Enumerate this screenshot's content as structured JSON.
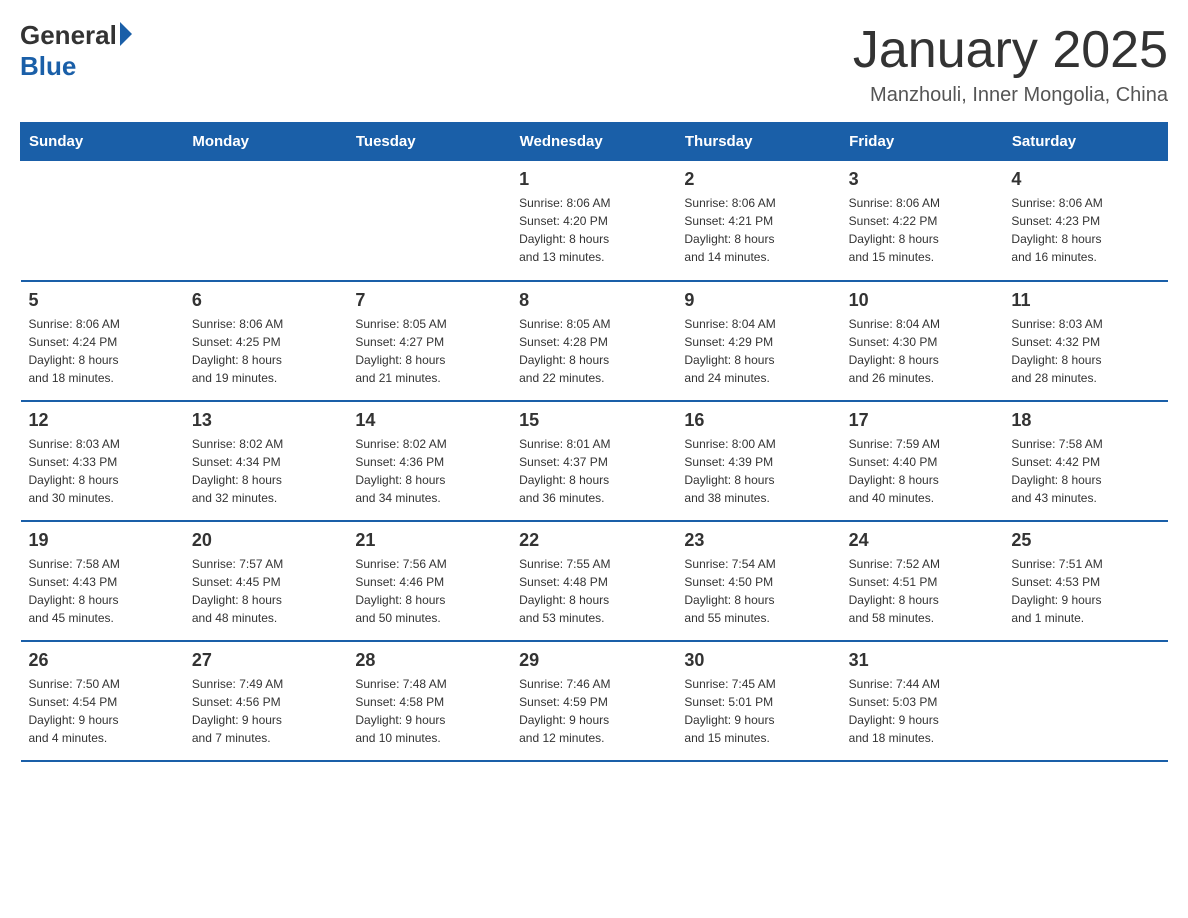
{
  "logo": {
    "general": "General",
    "blue": "Blue"
  },
  "header": {
    "title": "January 2025",
    "subtitle": "Manzhouli, Inner Mongolia, China"
  },
  "weekdays": [
    "Sunday",
    "Monday",
    "Tuesday",
    "Wednesday",
    "Thursday",
    "Friday",
    "Saturday"
  ],
  "weeks": [
    [
      {
        "day": "",
        "info": ""
      },
      {
        "day": "",
        "info": ""
      },
      {
        "day": "",
        "info": ""
      },
      {
        "day": "1",
        "info": "Sunrise: 8:06 AM\nSunset: 4:20 PM\nDaylight: 8 hours\nand 13 minutes."
      },
      {
        "day": "2",
        "info": "Sunrise: 8:06 AM\nSunset: 4:21 PM\nDaylight: 8 hours\nand 14 minutes."
      },
      {
        "day": "3",
        "info": "Sunrise: 8:06 AM\nSunset: 4:22 PM\nDaylight: 8 hours\nand 15 minutes."
      },
      {
        "day": "4",
        "info": "Sunrise: 8:06 AM\nSunset: 4:23 PM\nDaylight: 8 hours\nand 16 minutes."
      }
    ],
    [
      {
        "day": "5",
        "info": "Sunrise: 8:06 AM\nSunset: 4:24 PM\nDaylight: 8 hours\nand 18 minutes."
      },
      {
        "day": "6",
        "info": "Sunrise: 8:06 AM\nSunset: 4:25 PM\nDaylight: 8 hours\nand 19 minutes."
      },
      {
        "day": "7",
        "info": "Sunrise: 8:05 AM\nSunset: 4:27 PM\nDaylight: 8 hours\nand 21 minutes."
      },
      {
        "day": "8",
        "info": "Sunrise: 8:05 AM\nSunset: 4:28 PM\nDaylight: 8 hours\nand 22 minutes."
      },
      {
        "day": "9",
        "info": "Sunrise: 8:04 AM\nSunset: 4:29 PM\nDaylight: 8 hours\nand 24 minutes."
      },
      {
        "day": "10",
        "info": "Sunrise: 8:04 AM\nSunset: 4:30 PM\nDaylight: 8 hours\nand 26 minutes."
      },
      {
        "day": "11",
        "info": "Sunrise: 8:03 AM\nSunset: 4:32 PM\nDaylight: 8 hours\nand 28 minutes."
      }
    ],
    [
      {
        "day": "12",
        "info": "Sunrise: 8:03 AM\nSunset: 4:33 PM\nDaylight: 8 hours\nand 30 minutes."
      },
      {
        "day": "13",
        "info": "Sunrise: 8:02 AM\nSunset: 4:34 PM\nDaylight: 8 hours\nand 32 minutes."
      },
      {
        "day": "14",
        "info": "Sunrise: 8:02 AM\nSunset: 4:36 PM\nDaylight: 8 hours\nand 34 minutes."
      },
      {
        "day": "15",
        "info": "Sunrise: 8:01 AM\nSunset: 4:37 PM\nDaylight: 8 hours\nand 36 minutes."
      },
      {
        "day": "16",
        "info": "Sunrise: 8:00 AM\nSunset: 4:39 PM\nDaylight: 8 hours\nand 38 minutes."
      },
      {
        "day": "17",
        "info": "Sunrise: 7:59 AM\nSunset: 4:40 PM\nDaylight: 8 hours\nand 40 minutes."
      },
      {
        "day": "18",
        "info": "Sunrise: 7:58 AM\nSunset: 4:42 PM\nDaylight: 8 hours\nand 43 minutes."
      }
    ],
    [
      {
        "day": "19",
        "info": "Sunrise: 7:58 AM\nSunset: 4:43 PM\nDaylight: 8 hours\nand 45 minutes."
      },
      {
        "day": "20",
        "info": "Sunrise: 7:57 AM\nSunset: 4:45 PM\nDaylight: 8 hours\nand 48 minutes."
      },
      {
        "day": "21",
        "info": "Sunrise: 7:56 AM\nSunset: 4:46 PM\nDaylight: 8 hours\nand 50 minutes."
      },
      {
        "day": "22",
        "info": "Sunrise: 7:55 AM\nSunset: 4:48 PM\nDaylight: 8 hours\nand 53 minutes."
      },
      {
        "day": "23",
        "info": "Sunrise: 7:54 AM\nSunset: 4:50 PM\nDaylight: 8 hours\nand 55 minutes."
      },
      {
        "day": "24",
        "info": "Sunrise: 7:52 AM\nSunset: 4:51 PM\nDaylight: 8 hours\nand 58 minutes."
      },
      {
        "day": "25",
        "info": "Sunrise: 7:51 AM\nSunset: 4:53 PM\nDaylight: 9 hours\nand 1 minute."
      }
    ],
    [
      {
        "day": "26",
        "info": "Sunrise: 7:50 AM\nSunset: 4:54 PM\nDaylight: 9 hours\nand 4 minutes."
      },
      {
        "day": "27",
        "info": "Sunrise: 7:49 AM\nSunset: 4:56 PM\nDaylight: 9 hours\nand 7 minutes."
      },
      {
        "day": "28",
        "info": "Sunrise: 7:48 AM\nSunset: 4:58 PM\nDaylight: 9 hours\nand 10 minutes."
      },
      {
        "day": "29",
        "info": "Sunrise: 7:46 AM\nSunset: 4:59 PM\nDaylight: 9 hours\nand 12 minutes."
      },
      {
        "day": "30",
        "info": "Sunrise: 7:45 AM\nSunset: 5:01 PM\nDaylight: 9 hours\nand 15 minutes."
      },
      {
        "day": "31",
        "info": "Sunrise: 7:44 AM\nSunset: 5:03 PM\nDaylight: 9 hours\nand 18 minutes."
      },
      {
        "day": "",
        "info": ""
      }
    ]
  ]
}
